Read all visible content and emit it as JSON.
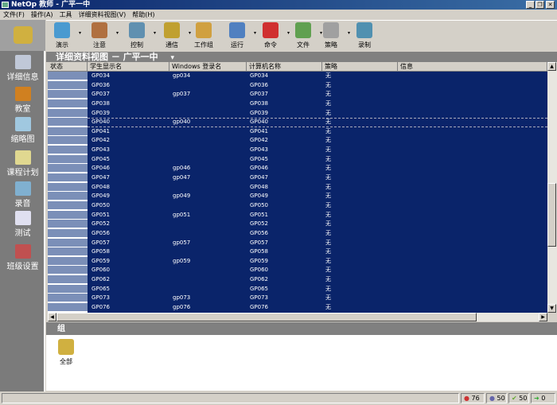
{
  "window": {
    "title": "NetOp 教师 - 广平一中",
    "minimize": "_",
    "restore": "❐",
    "close": "✕"
  },
  "menu": [
    "文件(F)",
    "操作(A)",
    "工具",
    "详细资料视图(V)",
    "帮助(H)"
  ],
  "toolbar": [
    {
      "label": "演示",
      "icon": "demo-icon",
      "color": "#4a9ad0",
      "dd": true
    },
    {
      "label": "注意",
      "icon": "attention-icon",
      "color": "#b07040",
      "dd": true
    },
    {
      "label": "控制",
      "icon": "control-icon",
      "color": "#6090b0",
      "dd": true
    },
    {
      "label": "通信",
      "icon": "communicate-icon",
      "color": "#c0a030",
      "dd": true
    },
    {
      "label": "工作组",
      "icon": "workgroup-icon",
      "color": "#d0a040",
      "dd": false
    },
    {
      "label": "运行",
      "icon": "run-icon",
      "color": "#5080c0",
      "dd": true
    },
    {
      "label": "命令",
      "icon": "command-icon",
      "color": "#d03030",
      "dd": true
    },
    {
      "label": "文件",
      "icon": "file-icon",
      "color": "#60a050",
      "dd": true
    },
    {
      "label": "策略",
      "icon": "policy-icon",
      "color": "#a0a0a0",
      "dd": true
    },
    {
      "label": "录制",
      "icon": "record-icon",
      "color": "#5090b0",
      "dd": false
    }
  ],
  "sidebar": [
    {
      "label": "详细信息",
      "icon": "details-icon",
      "color": "#c0c8d8"
    },
    {
      "label": "教室",
      "icon": "classroom-icon",
      "color": "#d08020"
    },
    {
      "label": "缩略图",
      "icon": "thumbnail-icon",
      "color": "#a0c8e0"
    },
    {
      "label": "课程计划",
      "icon": "lesson-plan-icon",
      "color": "#e0d890"
    },
    {
      "label": "录音",
      "icon": "recording-icon",
      "color": "#80b0d0"
    },
    {
      "label": "测试",
      "icon": "test-icon",
      "color": "#e0e0f0"
    },
    {
      "label": "班级设置",
      "icon": "class-settings-icon",
      "color": "#c05050"
    }
  ],
  "view": {
    "title": "详细资料视图 － 广平一中",
    "dropdown": "▾"
  },
  "columns": [
    "状态",
    "学生显示名",
    "Windows 登录名",
    "计算机名称",
    "策略",
    "信息"
  ],
  "rows": [
    [
      "GP034",
      "gp034",
      "GP034",
      "无"
    ],
    [
      "GP036",
      "",
      "GP036",
      "无"
    ],
    [
      "GP037",
      "gp037",
      "GP037",
      "无"
    ],
    [
      "GP038",
      "",
      "GP038",
      "无"
    ],
    [
      "GP039",
      "",
      "GP039",
      "无"
    ],
    [
      "GP040",
      "gp040",
      "GP040",
      "无"
    ],
    [
      "GP041",
      "",
      "GP041",
      "无"
    ],
    [
      "GP042",
      "",
      "GP042",
      "无"
    ],
    [
      "GP043",
      "",
      "GP043",
      "无"
    ],
    [
      "GP045",
      "",
      "GP045",
      "无"
    ],
    [
      "GP046",
      "gp046",
      "GP046",
      "无"
    ],
    [
      "GP047",
      "gp047",
      "GP047",
      "无"
    ],
    [
      "GP048",
      "",
      "GP048",
      "无"
    ],
    [
      "GP049",
      "gp049",
      "GP049",
      "无"
    ],
    [
      "GP050",
      "",
      "GP050",
      "无"
    ],
    [
      "GP051",
      "gp051",
      "GP051",
      "无"
    ],
    [
      "GP052",
      "",
      "GP052",
      "无"
    ],
    [
      "GP056",
      "",
      "GP056",
      "无"
    ],
    [
      "GP057",
      "gp057",
      "GP057",
      "无"
    ],
    [
      "GP058",
      "",
      "GP058",
      "无"
    ],
    [
      "GP059",
      "gp059",
      "GP059",
      "无"
    ],
    [
      "GP060",
      "",
      "GP060",
      "无"
    ],
    [
      "GP062",
      "",
      "GP062",
      "无"
    ],
    [
      "GP065",
      "",
      "GP065",
      "无"
    ],
    [
      "GP073",
      "gp073",
      "GP073",
      "无"
    ],
    [
      "GP076",
      "gp076",
      "GP076",
      "无"
    ]
  ],
  "groups": {
    "title": "组",
    "items": [
      {
        "label": "全部"
      }
    ]
  },
  "statusbar": {
    "total": "76",
    "online": "50",
    "ok": "50",
    "other": "0"
  }
}
